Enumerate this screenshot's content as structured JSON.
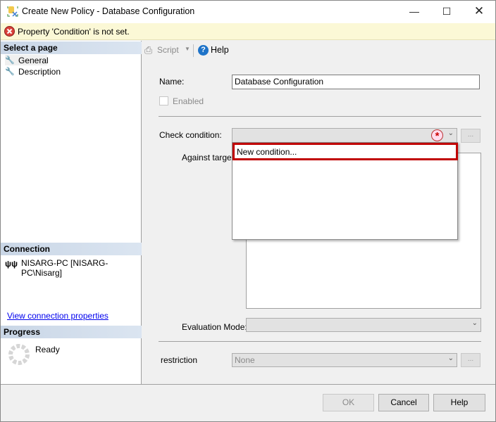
{
  "window": {
    "title": "Create New Policy - Database Configuration"
  },
  "banner": {
    "message": "Property 'Condition' is not set."
  },
  "sidebar": {
    "select_page_header": "Select a page",
    "pages": [
      {
        "label": "General"
      },
      {
        "label": "Description"
      }
    ],
    "connection_header": "Connection",
    "connection": "NISARG-PC [NISARG-PC\\Nisarg]",
    "view_connection_link": "View connection properties",
    "progress_header": "Progress",
    "progress_status": "Ready"
  },
  "toolbar": {
    "script_label": "Script",
    "help_label": "Help"
  },
  "form": {
    "name_label": "Name:",
    "name_value": "Database Configuration",
    "enabled_label": "Enabled",
    "check_condition_label": "Check condition:",
    "check_condition_options": [
      "New condition..."
    ],
    "ellipsis": "...",
    "against_targets_label": "Against targets:",
    "evaluation_mode_label": "Evaluation Mode:",
    "restriction_label": "restriction",
    "restriction_value": "None"
  },
  "buttons": {
    "ok": "OK",
    "cancel": "Cancel",
    "help": "Help"
  },
  "colors": {
    "highlight_border": "#c00000",
    "banner_bg": "#fbf8d6"
  }
}
